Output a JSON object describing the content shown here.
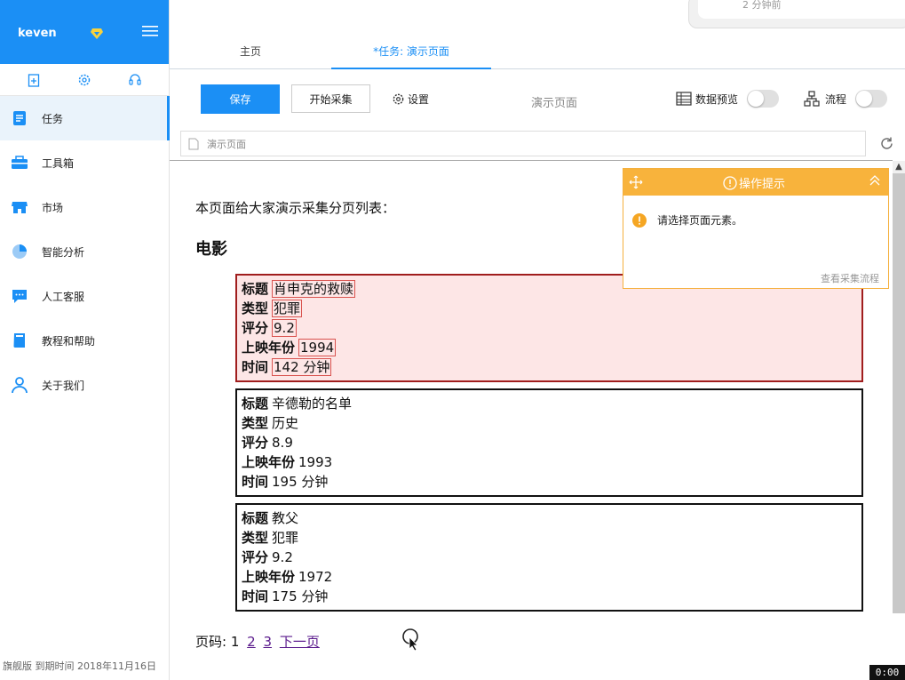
{
  "user": {
    "name": "keven"
  },
  "sidebar": {
    "items": [
      {
        "label": "任务",
        "icon": "task-icon"
      },
      {
        "label": "工具箱",
        "icon": "toolbox-icon"
      },
      {
        "label": "市场",
        "icon": "market-icon"
      },
      {
        "label": "智能分析",
        "icon": "pie-chart-icon"
      },
      {
        "label": "人工客服",
        "icon": "chat-icon"
      },
      {
        "label": "教程和帮助",
        "icon": "book-icon"
      },
      {
        "label": "关于我们",
        "icon": "person-icon"
      }
    ],
    "footer": "旗舰版  到期时间  2018年11月16日"
  },
  "tabs": [
    {
      "label": "主页"
    },
    {
      "label": "*任务: 演示页面"
    }
  ],
  "toolbar": {
    "save_label": "保存",
    "start_label": "开始采集",
    "settings_label": "设置",
    "page_title": "演示页面",
    "preview_label": "数据预览",
    "flow_label": "流程"
  },
  "urlbar": {
    "value": "演示页面"
  },
  "notification": {
    "text": "2 分钟前"
  },
  "page": {
    "intro": "本页面给大家演示采集分页列表：",
    "heading": "电影",
    "movies": [
      {
        "title_label": "标题",
        "title": "肖申克的救赎",
        "type_label": "类型",
        "type": "犯罪",
        "rating_label": "评分",
        "rating": "9.2",
        "year_label": "上映年份",
        "year": "1994",
        "duration_label": "时间",
        "duration": "142 分钟"
      },
      {
        "title_label": "标题",
        "title": "辛德勒的名单",
        "type_label": "类型",
        "type": "历史",
        "rating_label": "评分",
        "rating": "8.9",
        "year_label": "上映年份",
        "year": "1993",
        "duration_label": "时间",
        "duration": "195 分钟"
      },
      {
        "title_label": "标题",
        "title": "教父",
        "type_label": "类型",
        "type": "犯罪",
        "rating_label": "评分",
        "rating": "9.2",
        "year_label": "上映年份",
        "year": "1972",
        "duration_label": "时间",
        "duration": "175 分钟"
      }
    ],
    "pager": {
      "label": "页码: 1",
      "p2": "2",
      "p3": "3",
      "next": "下一页"
    }
  },
  "tip": {
    "title": "操作提示",
    "message": "请选择页面元素。",
    "link": "查看采集流程"
  },
  "timer": "0:00",
  "colors": {
    "accent": "#1b8ff5",
    "tip": "#f8b33c",
    "selected_bg": "#fde6e6"
  }
}
